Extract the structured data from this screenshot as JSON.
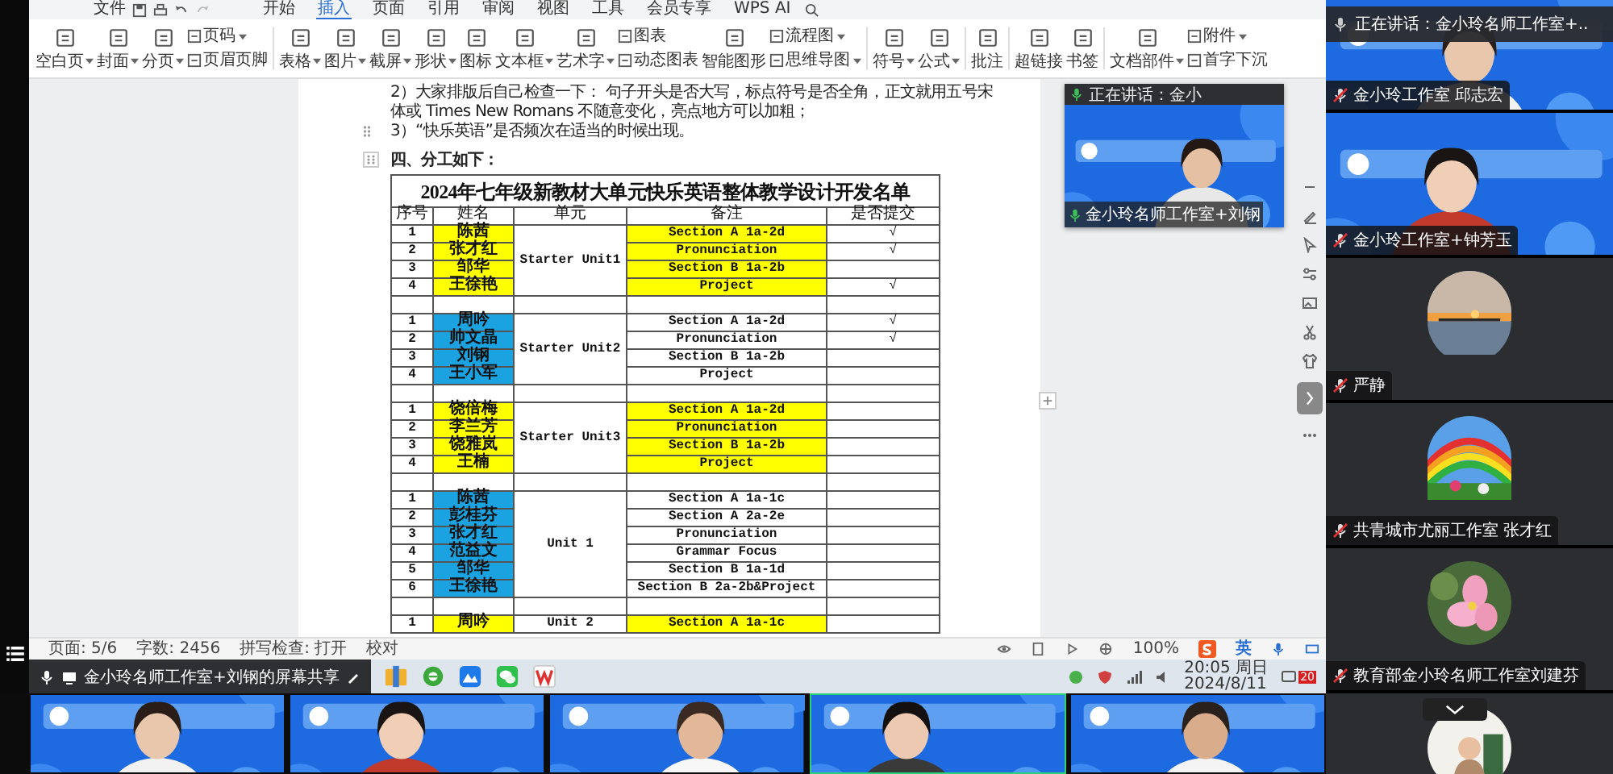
{
  "menu_bar": {
    "file": "文件",
    "tabs": [
      {
        "label": "开始",
        "selected": false
      },
      {
        "label": "插入",
        "selected": true
      },
      {
        "label": "页面",
        "selected": false
      },
      {
        "label": "引用",
        "selected": false
      },
      {
        "label": "审阅",
        "selected": false
      },
      {
        "label": "视图",
        "selected": false
      },
      {
        "label": "工具",
        "selected": false
      },
      {
        "label": "会员专享",
        "selected": false
      },
      {
        "label": "WPS AI",
        "selected": false
      }
    ]
  },
  "ribbon": [
    [
      {
        "kind": "big",
        "label": "空白页",
        "caret": true
      },
      {
        "kind": "big",
        "label": "封面",
        "caret": true
      },
      {
        "kind": "big",
        "label": "分页",
        "caret": true
      },
      {
        "kind": "stack",
        "rows": [
          {
            "label": "页码",
            "caret": true
          },
          {
            "label": "页眉页脚",
            "caret": false
          }
        ]
      }
    ],
    [
      {
        "kind": "big",
        "label": "表格",
        "caret": true
      },
      {
        "kind": "big",
        "label": "图片",
        "caret": true
      },
      {
        "kind": "big",
        "label": "截屏",
        "caret": true
      },
      {
        "kind": "big",
        "label": "形状",
        "caret": true
      },
      {
        "kind": "big",
        "label": "图标",
        "caret": false
      },
      {
        "kind": "big",
        "label": "文本框",
        "caret": true
      },
      {
        "kind": "big",
        "label": "艺术字",
        "caret": true
      },
      {
        "kind": "stack",
        "rows": [
          {
            "label": "图表",
            "caret": false
          },
          {
            "label": "动态图表",
            "caret": false
          }
        ]
      },
      {
        "kind": "big",
        "label": "智能图形",
        "caret": false
      },
      {
        "kind": "stack",
        "rows": [
          {
            "label": "流程图",
            "caret": true
          },
          {
            "label": "思维导图",
            "caret": true
          }
        ]
      }
    ],
    [
      {
        "kind": "big",
        "label": "符号",
        "caret": true
      },
      {
        "kind": "big",
        "label": "公式",
        "caret": true
      }
    ],
    [
      {
        "kind": "big",
        "label": "批注",
        "caret": false
      }
    ],
    [
      {
        "kind": "big",
        "label": "超链接",
        "caret": false
      },
      {
        "kind": "big",
        "label": "书签",
        "caret": false
      }
    ],
    [
      {
        "kind": "big",
        "label": "文档部件",
        "caret": true
      },
      {
        "kind": "stack",
        "rows": [
          {
            "label": "附件",
            "caret": true
          },
          {
            "label": "首字下沉",
            "caret": false
          }
        ]
      }
    ]
  ],
  "document": {
    "lines": [
      "2）大家排版后自己检查一下：  句子开头是否大写，标点符号是否全角，正文就用五号宋",
      "体或 Times New Romans 不随意变化，亮点地方可以加粗；",
      "3）“快乐英语”是否频次在适当的时候出现。"
    ],
    "heading": "四、分工如下：",
    "table": {
      "title": "2024年七年级新教材大单元快乐英语整体教学设计开发名单",
      "columns": [
        "序号",
        "姓名",
        "单元",
        "备注",
        "是否提交"
      ],
      "groups": [
        {
          "unit": "Starter Unit1",
          "color": "#ffff00",
          "notes_highlighted": true,
          "rows": [
            {
              "no": "1",
              "name": "陈茜",
              "note": "Section A 1a-2d",
              "submitted": "√"
            },
            {
              "no": "2",
              "name": "张才红",
              "note": "Pronunciation",
              "submitted": "√"
            },
            {
              "no": "3",
              "name": "邹华",
              "note": "Section B 1a-2b"
            },
            {
              "no": "4",
              "name": "王徐艳",
              "note": "Project",
              "submitted": "√"
            }
          ]
        },
        {
          "unit": "Starter Unit2",
          "color": "#1aa3e0",
          "notes_highlighted": false,
          "rows": [
            {
              "no": "1",
              "name": "周吟",
              "note": "Section A 1a-2d",
              "submitted": "√"
            },
            {
              "no": "2",
              "name": "帅文晶",
              "note": "Pronunciation",
              "submitted": "√"
            },
            {
              "no": "3",
              "name": "刘钢",
              "note": "Section B 1a-2b"
            },
            {
              "no": "4",
              "name": "王小军",
              "note": "Project"
            }
          ]
        },
        {
          "unit": "Starter Unit3",
          "color": "#ffff00",
          "notes_highlighted": true,
          "rows": [
            {
              "no": "1",
              "name": "饶倍梅",
              "note": "Section A 1a-2d"
            },
            {
              "no": "2",
              "name": "李兰芳",
              "note": "Pronunciation"
            },
            {
              "no": "3",
              "name": "饶雅岚",
              "note": "Section B 1a-2b"
            },
            {
              "no": "4",
              "name": "王楠",
              "note": "Project"
            }
          ]
        },
        {
          "unit": "Unit 1",
          "color": "#1aa3e0",
          "notes_highlighted": false,
          "rows": [
            {
              "no": "1",
              "name": "陈茜",
              "note": "Section A 1a-1c"
            },
            {
              "no": "2",
              "name": "彭桂芬",
              "note": "Section A 2a-2e"
            },
            {
              "no": "3",
              "name": "张才红",
              "note": "Pronunciation"
            },
            {
              "no": "4",
              "name": "范益文",
              "note": "Grammar Focus"
            },
            {
              "no": "5",
              "name": "邹华",
              "note": "Section B 1a-1d"
            },
            {
              "no": "6",
              "name": "王徐艳",
              "note": "Section B 2a-2b&Project"
            }
          ]
        },
        {
          "unit": "Unit 2",
          "color": "#ffff00",
          "notes_highlighted": true,
          "rows": [
            {
              "no": "1",
              "name": "周吟",
              "note": "Section A 1a-1c"
            }
          ]
        }
      ]
    }
  },
  "status_bar": {
    "items": [
      "页面: 5/6",
      "字数: 2456",
      "拼写检查: 打开",
      "校对"
    ],
    "zoom": "100%",
    "ime": "英"
  },
  "taskbar": {
    "share_label": "金小玲名师工作室+刘钢的屏幕共享",
    "time": "20:05 周日",
    "date": "2024/8/11",
    "notifications": "20"
  },
  "floating_video": {
    "title": "正在讲话：金小",
    "name": "金小玲名师工作室+刘钢"
  },
  "speaker_banner": "正在讲话：金小玲名师工作室+..",
  "side_tiles": [
    {
      "kind": "video",
      "name": "金小玲工作室 邱志宏",
      "muted": true
    },
    {
      "kind": "video",
      "name": "金小玲工作室+钟芳玉",
      "muted": true
    },
    {
      "kind": "avatar",
      "name": "严静",
      "muted": true
    },
    {
      "kind": "avatar",
      "name": "共青城市尤丽工作室 张才红",
      "muted": true
    },
    {
      "kind": "avatar",
      "name": "教育部金小玲名师工作室刘建芬",
      "muted": true
    },
    {
      "kind": "avatar"
    }
  ],
  "bottom_videos": [
    {
      "kind": "picture",
      "speaking": false
    },
    {
      "kind": "picture",
      "speaking": false
    },
    {
      "kind": "picture",
      "speaking": false
    },
    {
      "kind": "picture",
      "speaking": true
    },
    {
      "kind": "picture",
      "speaking": false
    }
  ]
}
